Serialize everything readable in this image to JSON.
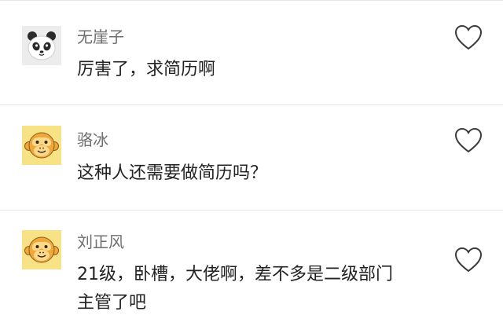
{
  "comments": [
    {
      "username": "无崖子",
      "avatar_icon": "panda-icon",
      "text_lines": [
        "厉害了，求简历啊"
      ]
    },
    {
      "username": "骆冰",
      "avatar_icon": "monkey-icon",
      "text_lines": [
        "这种人还需要做简历吗？"
      ]
    },
    {
      "username": "刘正风",
      "avatar_icon": "monkey-icon",
      "text_lines": [
        "21级，卧槽，大佬啊，差不多是二级部门",
        "主管了吧"
      ]
    }
  ],
  "like_icon": "heart-outline-icon",
  "colors": {
    "username": "#6f6f6f",
    "text": "#222222",
    "divider": "#e6e6e6",
    "monkey_bg": "#f7e386",
    "panda_bg": "#ececec"
  }
}
